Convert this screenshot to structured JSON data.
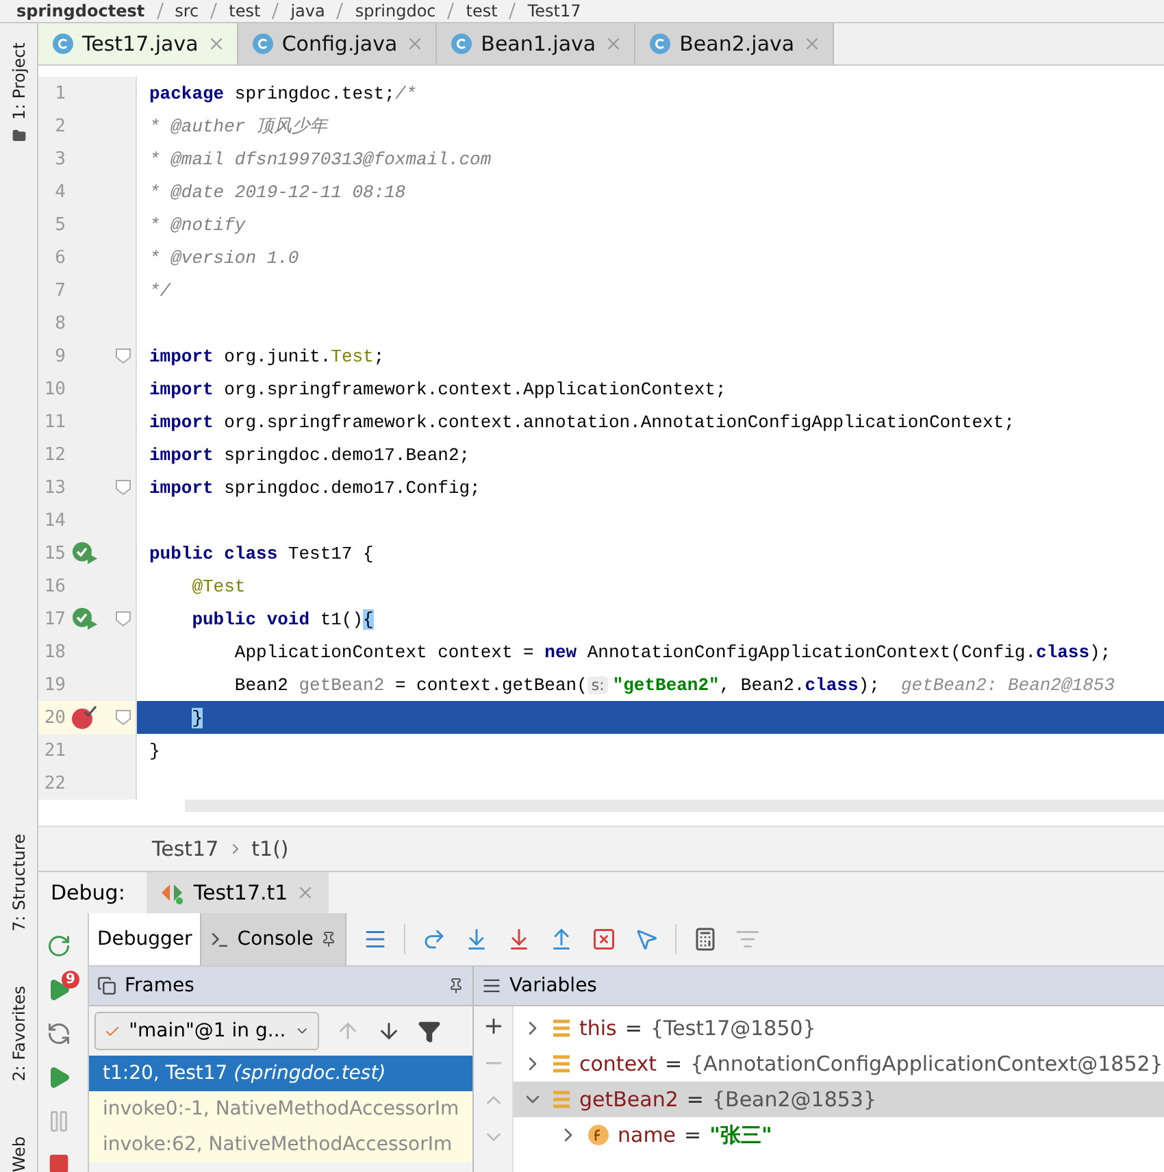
{
  "breadcrumb": [
    "springdoctest",
    "src",
    "test",
    "java",
    "springdoc",
    "test",
    "Test17"
  ],
  "tool_windows": [
    {
      "label": "1: Project"
    },
    {
      "label": "7: Structure"
    },
    {
      "label": "2: Favorites"
    },
    {
      "label": "Web"
    }
  ],
  "tabs": [
    {
      "label": "Test17.java",
      "selected": true
    },
    {
      "label": "Config.java",
      "selected": false
    },
    {
      "label": "Bean1.java",
      "selected": false
    },
    {
      "label": "Bean2.java",
      "selected": false
    }
  ],
  "editor": {
    "lines": [
      {
        "number": "1",
        "kind": "plain",
        "fold": false,
        "current": false,
        "tokens": [
          {
            "kind": "kw",
            "text": "package"
          },
          {
            "kind": "plain",
            "text": " springdoc.test;"
          },
          {
            "kind": "comment",
            "text": "/*"
          }
        ]
      },
      {
        "number": "2",
        "kind": "plain",
        "fold": false,
        "current": false,
        "tokens": [
          {
            "kind": "comment",
            "text": "* @auther 顶风少年"
          }
        ]
      },
      {
        "number": "3",
        "kind": "plain",
        "fold": false,
        "current": false,
        "tokens": [
          {
            "kind": "comment",
            "text": "* @mail dfsn19970313@foxmail.com"
          }
        ]
      },
      {
        "number": "4",
        "kind": "plain",
        "fold": false,
        "current": false,
        "tokens": [
          {
            "kind": "comment",
            "text": "* @date 2019-12-11 08:18"
          }
        ]
      },
      {
        "number": "5",
        "kind": "plain",
        "fold": false,
        "current": false,
        "tokens": [
          {
            "kind": "comment",
            "text": "* @notify"
          }
        ]
      },
      {
        "number": "6",
        "kind": "plain",
        "fold": false,
        "current": false,
        "tokens": [
          {
            "kind": "comment",
            "text": "* @version 1.0"
          }
        ]
      },
      {
        "number": "7",
        "kind": "plain",
        "fold": false,
        "current": false,
        "tokens": [
          {
            "kind": "comment",
            "text": "*/"
          }
        ]
      },
      {
        "number": "8",
        "kind": "plain",
        "fold": false,
        "current": false
      },
      {
        "number": "9",
        "kind": "plain",
        "fold": true,
        "current": false,
        "tokens": [
          {
            "kind": "kw",
            "text": "import"
          },
          {
            "kind": "plain",
            "text": " org.junit."
          },
          {
            "kind": "annotation",
            "text": "Test"
          },
          {
            "kind": "plain",
            "text": ";"
          }
        ]
      },
      {
        "number": "10",
        "kind": "plain",
        "fold": false,
        "current": false,
        "tokens": [
          {
            "kind": "kw",
            "text": "import"
          },
          {
            "kind": "plain",
            "text": " org.springframework.context.ApplicationContext;"
          }
        ]
      },
      {
        "number": "11",
        "kind": "plain",
        "fold": false,
        "current": false,
        "tokens": [
          {
            "kind": "kw",
            "text": "import"
          },
          {
            "kind": "plain",
            "text": " org.springframework.context.annotation.AnnotationConfigApplicationContext;"
          }
        ]
      },
      {
        "number": "12",
        "kind": "plain",
        "fold": false,
        "current": false,
        "tokens": [
          {
            "kind": "kw",
            "text": "import"
          },
          {
            "kind": "plain",
            "text": " springdoc.demo17.Bean2;"
          }
        ]
      },
      {
        "number": "13",
        "kind": "plain",
        "fold": true,
        "current": false,
        "tokens": [
          {
            "kind": "kw",
            "text": "import"
          },
          {
            "kind": "plain",
            "text": " springdoc.demo17.Config;"
          }
        ]
      },
      {
        "number": "14",
        "kind": "plain",
        "fold": false,
        "current": false
      },
      {
        "number": "15",
        "kind": "run",
        "fold": false,
        "current": false,
        "tokens": [
          {
            "kind": "kw",
            "text": "public class"
          },
          {
            "kind": "plain",
            "text": " Test17 {"
          }
        ]
      },
      {
        "number": "16",
        "kind": "plain",
        "fold": false,
        "current": false,
        "tokens": [
          {
            "kind": "annotation",
            "text": "    @Test"
          }
        ]
      },
      {
        "number": "17",
        "kind": "run",
        "fold": true,
        "current": false,
        "tokens": [
          {
            "kind": "kw",
            "text": "    public void"
          },
          {
            "kind": "plain",
            "text": " t1()"
          },
          {
            "kind": "brace",
            "text": "{"
          }
        ]
      },
      {
        "number": "18",
        "kind": "plain",
        "fold": false,
        "current": false,
        "tokens": [
          {
            "kind": "plain",
            "text": "        ApplicationContext context = "
          },
          {
            "kind": "kw",
            "text": "new"
          },
          {
            "kind": "plain",
            "text": " AnnotationConfigApplicationContext(Config."
          },
          {
            "kind": "kw",
            "text": "class"
          },
          {
            "kind": "plain",
            "text": ");"
          }
        ]
      },
      {
        "number": "19",
        "kind": "plain",
        "fold": false,
        "current": false,
        "tokens": [
          {
            "kind": "plain",
            "text": "        Bean2 "
          },
          {
            "kind": "unused",
            "text": "getBean2"
          },
          {
            "kind": "plain",
            "text": " = context.getBean("
          },
          {
            "kind": "param_hint",
            "text": "s:"
          },
          {
            "kind": "string",
            "text": "\"getBean2\""
          },
          {
            "kind": "plain",
            "text": ", Bean2."
          },
          {
            "kind": "kw",
            "text": "class"
          },
          {
            "kind": "plain",
            "text": ");"
          },
          {
            "kind": "hint",
            "text": "getBean2: Bean2@1853"
          }
        ]
      },
      {
        "number": "20",
        "kind": "breakpoint",
        "fold": true,
        "current": true,
        "tokens": [
          {
            "kind": "brace",
            "text": "    }"
          }
        ]
      },
      {
        "number": "21",
        "kind": "plain",
        "fold": false,
        "current": false,
        "tokens": [
          {
            "kind": "plain",
            "text": "}"
          }
        ]
      },
      {
        "number": "22",
        "kind": "plain",
        "fold": false,
        "current": false
      }
    ]
  },
  "nav_bar": [
    "Test17",
    "t1()"
  ],
  "debug": {
    "title": "Debug:",
    "session_tab": "Test17.t1",
    "run_badge": "9",
    "tabs": [
      {
        "label": "Debugger",
        "selected": true
      },
      {
        "label": "Console",
        "selected": false
      }
    ],
    "frames": {
      "header": "Frames",
      "thread": "\"main\"@1 in g...",
      "rows": [
        {
          "text": "t1:20, Test17 *(springdoc.test)*",
          "kind": "user",
          "selected": true
        },
        {
          "text": "invoke0:-1, NativeMethodAccessorIm",
          "kind": "library",
          "selected": false
        },
        {
          "text": "invoke:62, NativeMethodAccessorIm",
          "kind": "library",
          "selected": false
        }
      ]
    },
    "variables": {
      "header": "Variables",
      "rows": [
        {
          "name": "this",
          "operator": "=",
          "value": "{Test17@1850}",
          "kind": "object",
          "expanded": false,
          "selected": false
        },
        {
          "name": "context",
          "operator": "=",
          "value": "{AnnotationConfigApplicationContext@1852}",
          "kind": "object",
          "expanded": false,
          "selected": false
        },
        {
          "name": "getBean2",
          "operator": "=",
          "value": "{Bean2@1853}",
          "kind": "object",
          "expanded": true,
          "selected": true,
          "children": [
            {
              "name": "name",
              "operator": "=",
              "value": "\"张三\"",
              "kind": "string_field",
              "expanded": false,
              "selected": false
            }
          ]
        }
      ]
    }
  }
}
